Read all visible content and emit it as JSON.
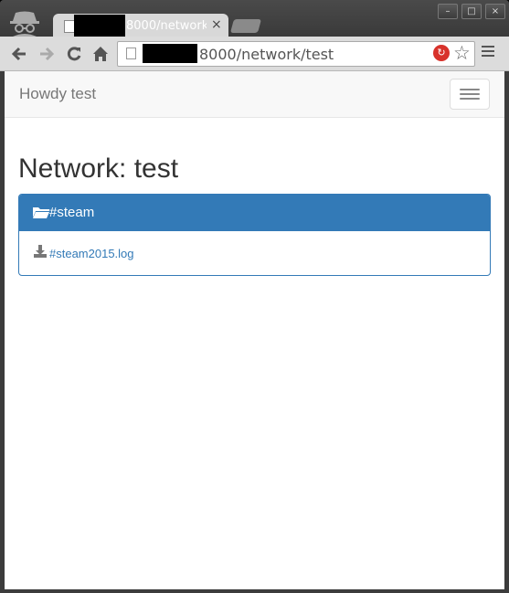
{
  "browser": {
    "tab_title": "8000/network",
    "tab_close": "×",
    "url": "8000/network/test",
    "window_controls": [
      "–",
      "□",
      "×"
    ],
    "icons": [
      "incognito-icon",
      "back-icon",
      "forward-icon",
      "reload-icon",
      "home-icon",
      "star-icon",
      "menu-icon"
    ]
  },
  "navbar": {
    "brand": "Howdy test"
  },
  "main": {
    "heading": "Network: test",
    "panel": {
      "title": "#steam",
      "files": [
        "#steam2015.log"
      ]
    }
  },
  "colors": {
    "primary": "#337ab7",
    "navbar_bg": "#f8f8f8"
  }
}
